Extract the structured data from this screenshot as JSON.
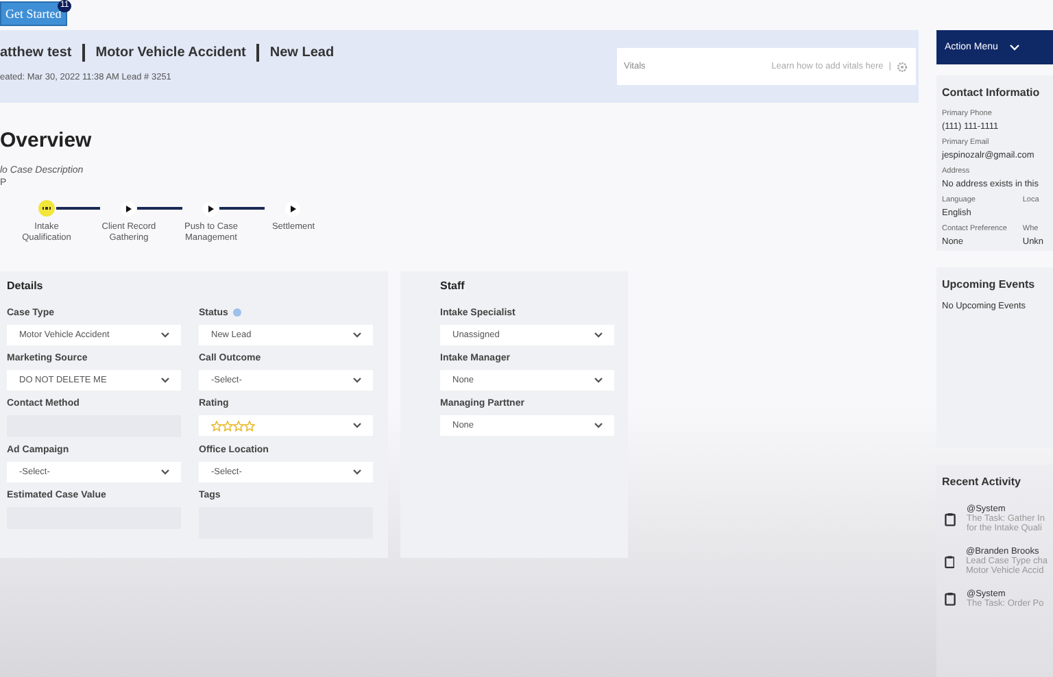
{
  "get_started": {
    "label": "Get Started",
    "badge": "11"
  },
  "header": {
    "name": "atthew test",
    "case_type": "Motor Vehicle Accident",
    "status": "New Lead",
    "meta": "eated: Mar 30, 2022 11:38 AM  Lead # 3251"
  },
  "vitals": {
    "title": "Vitals",
    "link": "Learn how to add vitals here",
    "separator": "|"
  },
  "overview": {
    "title": "Overview",
    "description": "lo Case Description",
    "extra": "P"
  },
  "stages": [
    {
      "label": "Intake Qualification",
      "kind": "current"
    },
    {
      "label": "Client Record Gathering",
      "kind": "pending"
    },
    {
      "label": "Push to Case Management",
      "kind": "pending"
    },
    {
      "label": "Settlement",
      "kind": "pending"
    }
  ],
  "details": {
    "title": "Details",
    "fields": [
      {
        "label": "Case Type",
        "kind": "select",
        "value": "Motor Vehicle Accident"
      },
      {
        "label": "Status",
        "kind": "select",
        "value": "New Lead",
        "info": true
      },
      {
        "label": "Marketing Source",
        "kind": "select",
        "value": "DO NOT DELETE ME"
      },
      {
        "label": "Call Outcome",
        "kind": "select",
        "value": "-Select-"
      },
      {
        "label": "Contact Method",
        "kind": "text"
      },
      {
        "label": "Rating",
        "kind": "rating",
        "stars": 0
      },
      {
        "label": "Ad Campaign",
        "kind": "select",
        "value": "-Select-"
      },
      {
        "label": "Office Location",
        "kind": "select",
        "value": "-Select-"
      },
      {
        "label": "Estimated Case Value",
        "kind": "text"
      },
      {
        "label": "Tags",
        "kind": "tags"
      }
    ]
  },
  "staff": {
    "title": "Staff",
    "fields": [
      {
        "label": "Intake Specialist",
        "value": "Unassigned"
      },
      {
        "label": "Intake Manager",
        "value": "None"
      },
      {
        "label": "Managing Parttner",
        "value": "None"
      }
    ]
  },
  "action_menu": {
    "label": "Action Menu"
  },
  "contact": {
    "title": "Contact Informatio",
    "rows": [
      {
        "label": "Primary Phone",
        "value": "(111) 111-1111"
      },
      {
        "label": "Primary Email",
        "value": "jespinozalr@gmail.com"
      },
      {
        "label": "Address",
        "value": "No address exists in this"
      }
    ],
    "pairs": [
      {
        "label": "Language",
        "value": "English",
        "label2": "Loca"
      },
      {
        "label": "Contact Preference",
        "value": "None",
        "label2": "Whe",
        "value2": "Unkn"
      }
    ]
  },
  "upcoming": {
    "title": "Upcoming Events",
    "empty": "No Upcoming Events"
  },
  "activity": {
    "title": "Recent Activity",
    "items": [
      {
        "author": "@System",
        "lines": [
          "The Task: Gather In",
          "for the Intake Quali"
        ]
      },
      {
        "author": "@Branden Brooks",
        "lines": [
          "Lead Case Type cha",
          "Motor Vehicle Accid"
        ]
      },
      {
        "author": "@System",
        "lines": [
          "The Task: Order Po"
        ]
      }
    ]
  }
}
